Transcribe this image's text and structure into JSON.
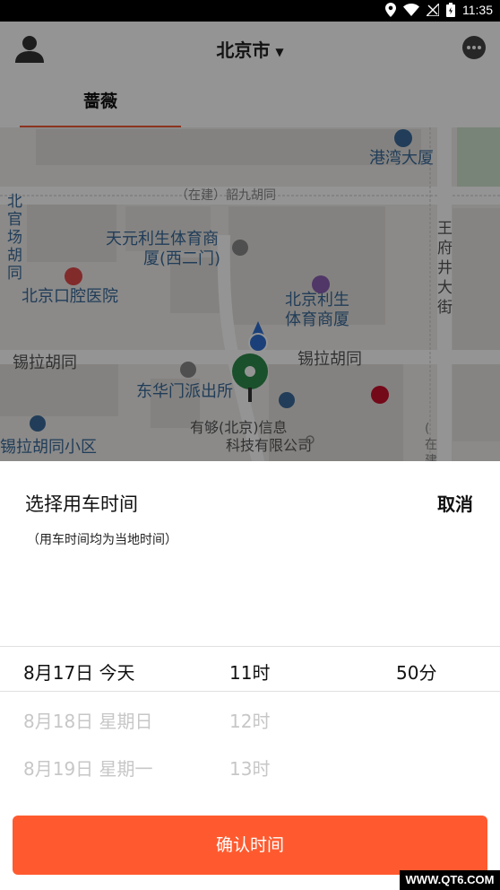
{
  "status_bar": {
    "time": "11:35"
  },
  "header": {
    "city": "北京市",
    "tab_label": "蔷薇"
  },
  "map": {
    "labels": {
      "hong_kong_building": "港湾大厦",
      "under_construction_hutong": "（在建）韶九胡同",
      "beiguanchang_hutong": "北官场胡同",
      "tianyuan_lisheng": "天元利生体育商厦(西二门)",
      "beijing_dental": "北京口腔医院",
      "beijing_lisheng": "北京利生体育商厦",
      "xila_hutong_left": "锡拉胡同",
      "xila_hutong_right": "锡拉胡同",
      "wangfujing": "王府井大街",
      "donghuamen_police": "东华门派出所",
      "xila_community": "锡拉胡同小区",
      "yougou_company": "有够(北京)信息科技有限公司",
      "under_construction_right": "(在建"
    },
    "icons": [
      "bank-icon",
      "hospital-icon",
      "shop-icon",
      "school-icon",
      "police-icon",
      "parking-icon",
      "pizza-hut-icon",
      "location-pin-icon",
      "current-location-icon"
    ]
  },
  "sheet": {
    "title": "选择用车时间",
    "subtitle": "（用车时间均为当地时间）",
    "cancel_label": "取消",
    "rows": [
      {
        "date": "8月17日 今天",
        "hour": "11时",
        "minute": "50分"
      },
      {
        "date": "8月18日 星期日",
        "hour": "12时",
        "minute": ""
      },
      {
        "date": "8月19日 星期一",
        "hour": "13时",
        "minute": ""
      }
    ],
    "confirm_label": "确认时间"
  },
  "watermark": "WWW.QT6.COM",
  "colors": {
    "accent": "#ff5a2f",
    "tab_underline": "#f2593a"
  }
}
